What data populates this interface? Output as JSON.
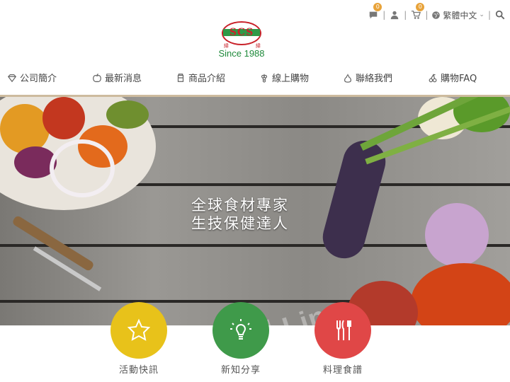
{
  "utility": {
    "message_count": "0",
    "cart_count": "0",
    "language": "繁體中文"
  },
  "logo": {
    "letters": "SCS",
    "cn_left": "緯",
    "cn_right": "緯",
    "since": "Since  1988"
  },
  "nav": [
    {
      "label": "公司簡介",
      "icon": "diamond-icon"
    },
    {
      "label": "最新消息",
      "icon": "apple-icon"
    },
    {
      "label": "商品介紹",
      "icon": "jar-icon"
    },
    {
      "label": "線上購物",
      "icon": "grapes-icon"
    },
    {
      "label": "聯絡我們",
      "icon": "pear-icon"
    },
    {
      "label": "購物FAQ",
      "icon": "cherry-icon"
    }
  ],
  "hero": {
    "line1": "全球食材專家",
    "line2": "生技保健達人",
    "watermark": "國 Line"
  },
  "features": [
    {
      "label": "活動快訊",
      "color": "#e8c21a",
      "icon": "star-icon"
    },
    {
      "label": "新知分享",
      "color": "#3f9a4a",
      "icon": "lightbulb-icon"
    },
    {
      "label": "料理食譜",
      "color": "#e04747",
      "icon": "utensils-icon"
    }
  ],
  "colors": {
    "accent_rule": "#cdbb9e",
    "logo_red": "#c9222a",
    "logo_green": "#1f8a3b",
    "badge": "#e8a33a"
  }
}
